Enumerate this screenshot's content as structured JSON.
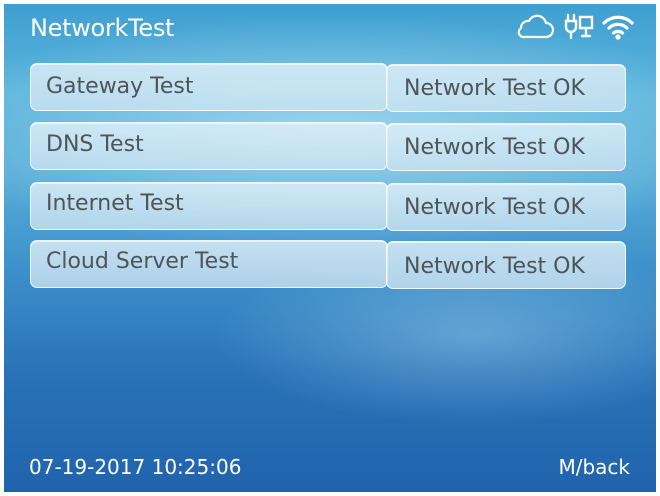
{
  "app": {
    "title": "NetworkTest"
  },
  "status_icons": [
    "cloud-icon",
    "ethernet-plug-icon",
    "wifi-icon"
  ],
  "tests": [
    {
      "name": "Gateway Test",
      "result": "Network Test OK"
    },
    {
      "name": "DNS Test",
      "result": "Network Test OK"
    },
    {
      "name": "Internet Test",
      "result": "Network Test OK"
    },
    {
      "name": "Cloud Server Test",
      "result": "Network Test OK"
    }
  ],
  "footer": {
    "datetime": "07-19-2017 10:25:06",
    "back_label": "M/back"
  },
  "colors": {
    "text_light": "#ffffff",
    "cell_text": "#4e5458",
    "background_top": "#3f9fd0",
    "background_bottom": "#1f63ac"
  }
}
